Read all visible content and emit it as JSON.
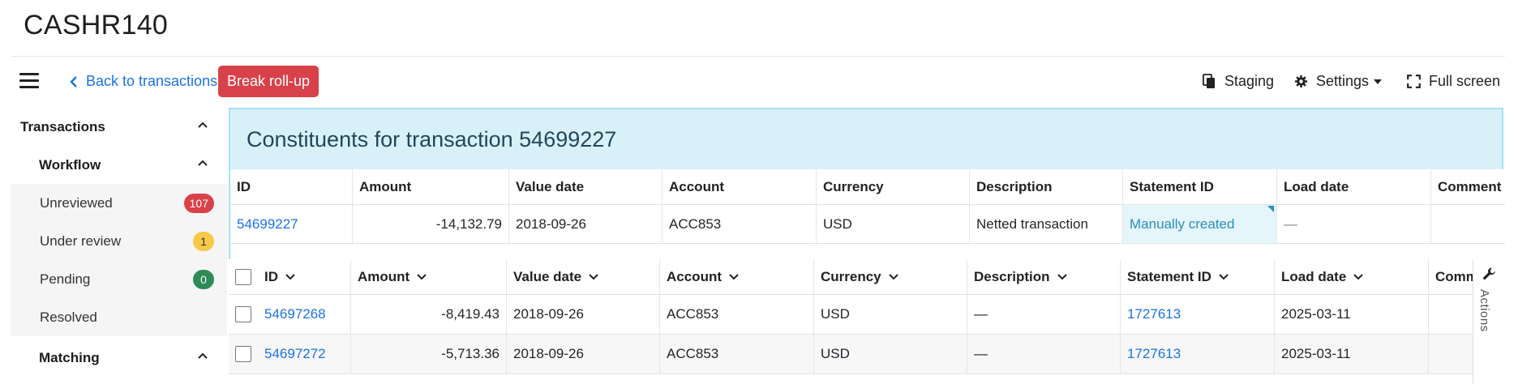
{
  "app": {
    "title": "CASHR140"
  },
  "toolbar": {
    "back_label": "Back to transactions",
    "break_label": "Break roll-up",
    "staging_label": "Staging",
    "settings_label": "Settings",
    "fullscreen_label": "Full screen"
  },
  "sidebar": {
    "transactions_label": "Transactions",
    "workflow_label": "Workflow",
    "items": [
      {
        "label": "Unreviewed",
        "badge": "107",
        "badge_color": "#d9414a"
      },
      {
        "label": "Under review",
        "badge": "1",
        "badge_color": "#f7c948"
      },
      {
        "label": "Pending",
        "badge": "0",
        "badge_color": "#2e8b57"
      },
      {
        "label": "Resolved",
        "badge": ""
      }
    ],
    "matching_label": "Matching"
  },
  "panel": {
    "title": "Constituents for transaction 54699227"
  },
  "parent_table": {
    "columns": [
      "ID",
      "Amount",
      "Value date",
      "Account",
      "Currency",
      "Description",
      "Statement ID",
      "Load date",
      "Comment"
    ],
    "row": {
      "id": "54699227",
      "amount": "-14,132.79",
      "value_date": "2018-09-26",
      "account": "ACC853",
      "currency": "USD",
      "description": "Netted transaction",
      "statement_id": "Manually created",
      "load_date": "—"
    }
  },
  "child_table": {
    "columns": [
      "ID",
      "Amount",
      "Value date",
      "Account",
      "Currency",
      "Description",
      "Statement ID",
      "Load date",
      "Comm"
    ],
    "rows": [
      {
        "id": "54697268",
        "amount": "-8,419.43",
        "value_date": "2018-09-26",
        "account": "ACC853",
        "currency": "USD",
        "description": "—",
        "statement_id": "1727613",
        "load_date": "2025-03-11"
      },
      {
        "id": "54697272",
        "amount": "-5,713.36",
        "value_date": "2018-09-26",
        "account": "ACC853",
        "currency": "USD",
        "description": "—",
        "statement_id": "1727613",
        "load_date": "2025-03-11"
      }
    ]
  },
  "actions_tab": {
    "label": "Actions"
  },
  "colors": {
    "accent": "#1a73e8",
    "danger": "#d9414a",
    "panel_bg": "#d8f1f9",
    "panel_border": "#a9e0f0"
  }
}
